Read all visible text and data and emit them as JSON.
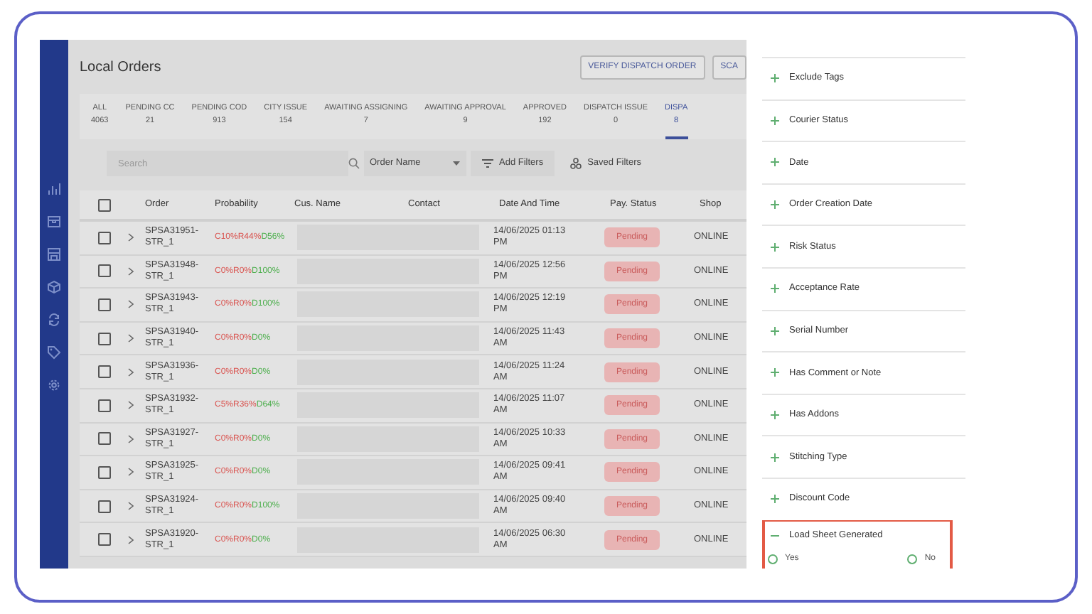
{
  "page": {
    "title": "Local Orders"
  },
  "header_buttons": [
    "VERIFY DISPATCH ORDER",
    "SCA"
  ],
  "tabs": [
    {
      "label": "ALL",
      "count": "4063",
      "selected": false
    },
    {
      "label": "PENDING CC",
      "count": "21",
      "selected": false
    },
    {
      "label": "PENDING COD",
      "count": "913",
      "selected": false
    },
    {
      "label": "CITY ISSUE",
      "count": "154",
      "selected": false
    },
    {
      "label": "AWAITING ASSIGNING",
      "count": "7",
      "selected": false
    },
    {
      "label": "AWAITING APPROVAL",
      "count": "9",
      "selected": false
    },
    {
      "label": "APPROVED",
      "count": "192",
      "selected": false
    },
    {
      "label": "DISPATCH ISSUE",
      "count": "0",
      "selected": false
    },
    {
      "label": "DISPA",
      "count": "8",
      "selected": true
    }
  ],
  "search": {
    "placeholder": "Search"
  },
  "sort_dropdown": {
    "value": "Order Name"
  },
  "filter_buttons": [
    "Add Filters",
    "Saved Filters"
  ],
  "table": {
    "select_all_checked": false,
    "columns": [
      "Order",
      "Probability",
      "Cus. Name",
      "Contact",
      "Date And Time",
      "Pay. Status",
      "Shop"
    ],
    "rows": [
      {
        "order": "SPSA31951-STR_1",
        "probability": [
          {
            "kind": "c",
            "text": "C10%"
          },
          {
            "kind": "r",
            "text": "R44%"
          },
          {
            "kind": "d",
            "text": "D56%"
          }
        ],
        "date": "14/06/2025 01:13 PM",
        "pay_status": "Pending",
        "shop": "ONLINE",
        "checked": false
      },
      {
        "order": "SPSA31948-STR_1",
        "probability": [
          {
            "kind": "c",
            "text": "C0%"
          },
          {
            "kind": "r",
            "text": "R0%"
          },
          {
            "kind": "d",
            "text": "D100%"
          }
        ],
        "date": "14/06/2025 12:56 PM",
        "pay_status": "Pending",
        "shop": "ONLINE",
        "checked": false
      },
      {
        "order": "SPSA31943-STR_1",
        "probability": [
          {
            "kind": "c",
            "text": "C0%"
          },
          {
            "kind": "r",
            "text": "R0%"
          },
          {
            "kind": "d",
            "text": "D100%"
          }
        ],
        "date": "14/06/2025 12:19 PM",
        "pay_status": "Pending",
        "shop": "ONLINE",
        "checked": false
      },
      {
        "order": "SPSA31940-STR_1",
        "probability": [
          {
            "kind": "c",
            "text": "C0%"
          },
          {
            "kind": "r",
            "text": "R0%"
          },
          {
            "kind": "d",
            "text": "D0%"
          }
        ],
        "date": "14/06/2025 11:43 AM",
        "pay_status": "Pending",
        "shop": "ONLINE",
        "checked": false
      },
      {
        "order": "SPSA31936-STR_1",
        "probability": [
          {
            "kind": "c",
            "text": "C0%"
          },
          {
            "kind": "r",
            "text": "R0%"
          },
          {
            "kind": "d",
            "text": "D0%"
          }
        ],
        "date": "14/06/2025 11:24 AM",
        "pay_status": "Pending",
        "shop": "ONLINE",
        "checked": false
      },
      {
        "order": "SPSA31932-STR_1",
        "probability": [
          {
            "kind": "c",
            "text": "C5%"
          },
          {
            "kind": "r",
            "text": "R36%"
          },
          {
            "kind": "d",
            "text": "D64%"
          }
        ],
        "date": "14/06/2025 11:07 AM",
        "pay_status": "Pending",
        "shop": "ONLINE",
        "checked": false
      },
      {
        "order": "SPSA31927-STR_1",
        "probability": [
          {
            "kind": "c",
            "text": "C0%"
          },
          {
            "kind": "r",
            "text": "R0%"
          },
          {
            "kind": "d",
            "text": "D0%"
          }
        ],
        "date": "14/06/2025 10:33 AM",
        "pay_status": "Pending",
        "shop": "ONLINE",
        "checked": false
      },
      {
        "order": "SPSA31925-STR_1",
        "probability": [
          {
            "kind": "c",
            "text": "C0%"
          },
          {
            "kind": "r",
            "text": "R0%"
          },
          {
            "kind": "d",
            "text": "D0%"
          }
        ],
        "date": "14/06/2025 09:41 AM",
        "pay_status": "Pending",
        "shop": "ONLINE",
        "checked": false
      },
      {
        "order": "SPSA31924-STR_1",
        "probability": [
          {
            "kind": "c",
            "text": "C0%"
          },
          {
            "kind": "r",
            "text": "R0%"
          },
          {
            "kind": "d",
            "text": "D100%"
          }
        ],
        "date": "14/06/2025 09:40 AM",
        "pay_status": "Pending",
        "shop": "ONLINE",
        "checked": false
      },
      {
        "order": "SPSA31920-STR_1",
        "probability": [
          {
            "kind": "c",
            "text": "C0%"
          },
          {
            "kind": "r",
            "text": "R0%"
          },
          {
            "kind": "d",
            "text": "D0%"
          }
        ],
        "date": "14/06/2025 06:30 AM",
        "pay_status": "Pending",
        "shop": "ONLINE",
        "checked": false
      }
    ]
  },
  "filter_panel": {
    "filters": [
      {
        "label": "Exclude Tags",
        "expanded": false
      },
      {
        "label": "Courier Status",
        "expanded": false
      },
      {
        "label": "Date",
        "expanded": false
      },
      {
        "label": "Order Creation Date",
        "expanded": false
      },
      {
        "label": "Risk Status",
        "expanded": false
      },
      {
        "label": "Acceptance Rate",
        "expanded": false
      },
      {
        "label": "Serial Number",
        "expanded": false
      },
      {
        "label": "Has Comment or Note",
        "expanded": false
      },
      {
        "label": "Has Addons",
        "expanded": false
      },
      {
        "label": "Stitching Type",
        "expanded": false
      },
      {
        "label": "Discount Code",
        "expanded": false
      },
      {
        "label": "Load Sheet Generated",
        "expanded": true,
        "highlighted": true,
        "options": [
          {
            "label": "Yes",
            "selected": false
          },
          {
            "label": "No",
            "selected": false
          }
        ]
      }
    ]
  }
}
